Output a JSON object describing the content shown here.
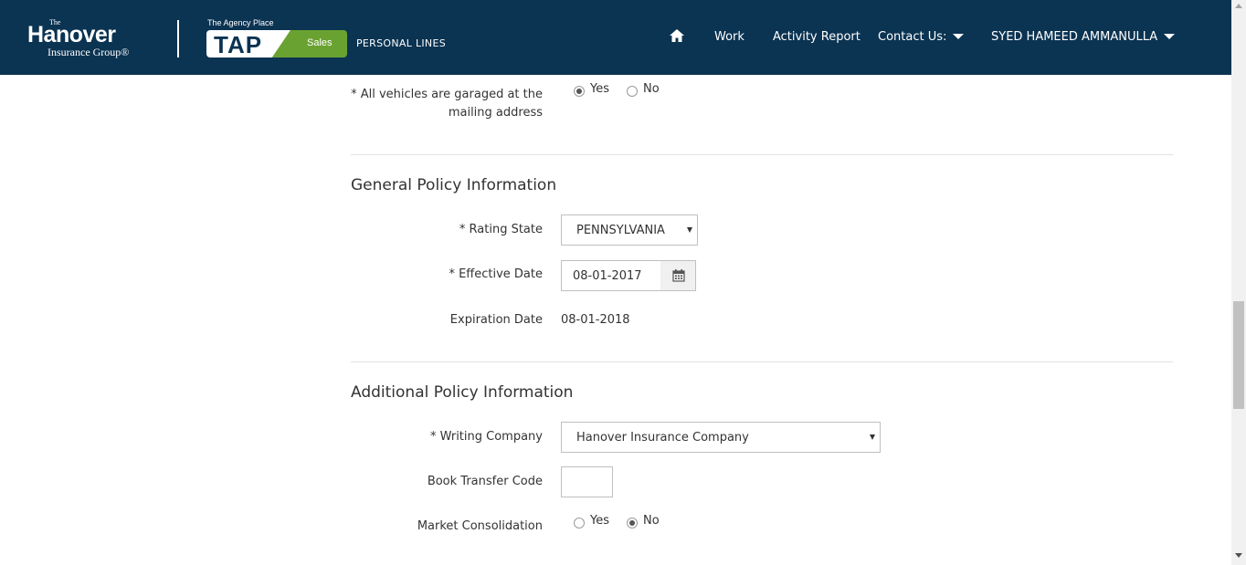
{
  "header": {
    "brand": {
      "the": "The",
      "name": "Hanover",
      "group": "Insurance Group®"
    },
    "tap": {
      "tagline": "The Agency Place",
      "logo": "TAP",
      "badge": "Sales"
    },
    "product_line": "PERSONAL LINES",
    "nav": {
      "home_icon": "home-icon",
      "work": "Work",
      "activity_report": "Activity Report",
      "contact_us": "Contact Us:",
      "user": "SYED HAMEED AMMANULLA"
    },
    "colors": {
      "header_bg": "#0b3352",
      "sales_green": "#6aa231"
    }
  },
  "garaged": {
    "label": "* All vehicles are garaged at the mailing address",
    "options": [
      "Yes",
      "No"
    ],
    "selected": "Yes"
  },
  "general_policy": {
    "title": "General Policy Information",
    "rating_state_label": "* Rating State",
    "rating_state_value": "PENNSYLVANIA",
    "effective_date_label": "* Effective Date",
    "effective_date_value": "08-01-2017",
    "calendar_icon": "calendar-icon",
    "expiration_date_label": "Expiration Date",
    "expiration_date_value": "08-01-2018"
  },
  "additional_policy": {
    "title": "Additional Policy Information",
    "writing_company_label": "* Writing Company",
    "writing_company_value": "Hanover Insurance Company",
    "book_transfer_label": "Book Transfer Code",
    "book_transfer_value": "",
    "market_consolidation_label": "Market Consolidation",
    "market_consolidation_options": [
      "Yes",
      "No"
    ],
    "market_consolidation_selected": "No"
  }
}
